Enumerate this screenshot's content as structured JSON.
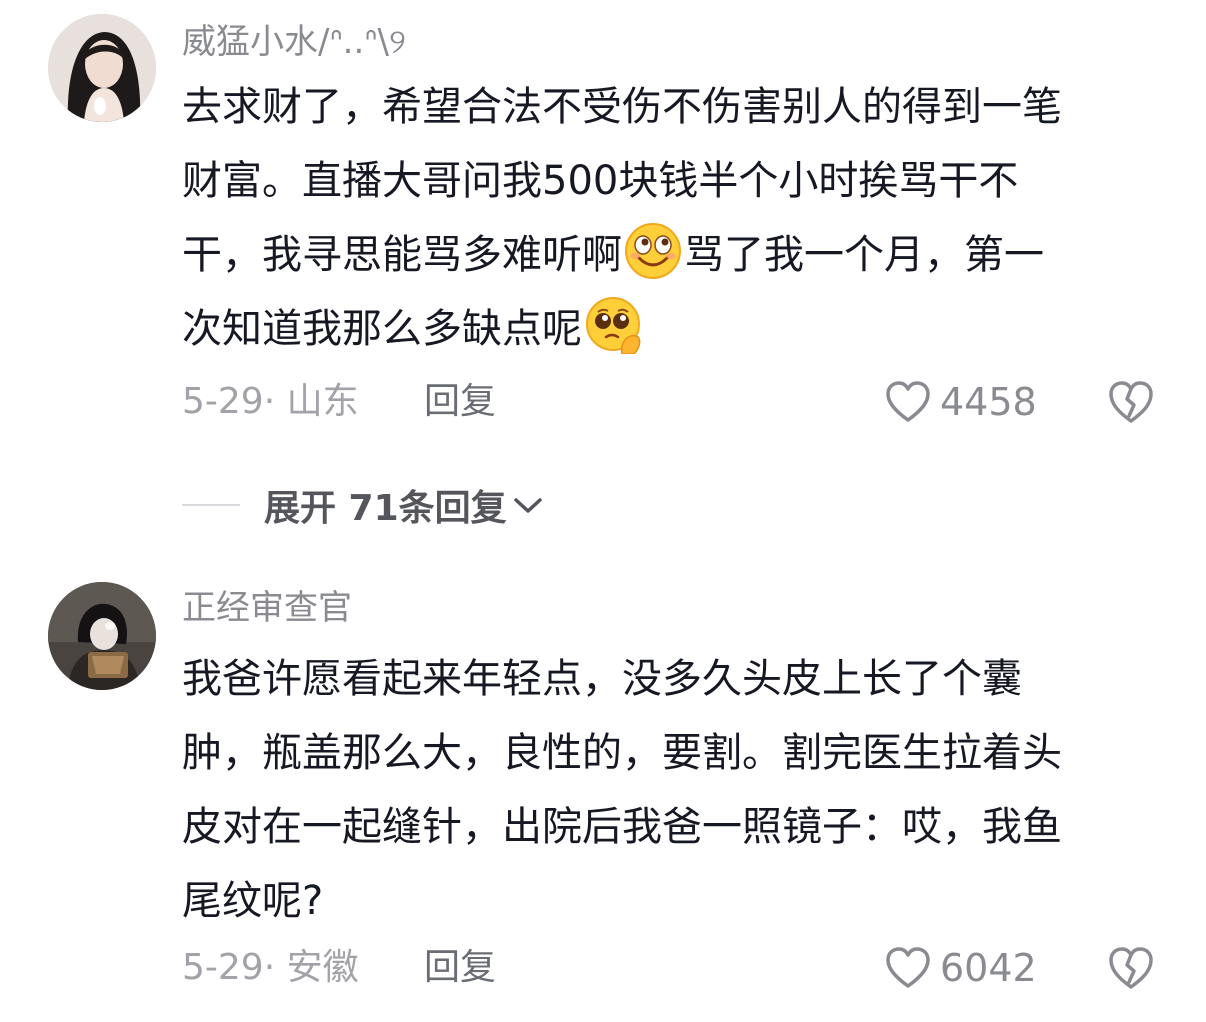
{
  "comments": [
    {
      "username": "威猛小水/ᐢ..ᐢ\\୨",
      "lines": [
        "去求财了，希望合法不受伤不伤害别人的得到一笔",
        "财富。直播大哥问我500块钱半个小时挨骂干不",
        "干，我寻思能骂多难听啊"
      ],
      "line3_after_emoji": "骂了我一个月，第一",
      "line4": "次知道我那么多缺点呢",
      "emoji_1": "grinning-rolling-eyes-emoji",
      "emoji_2": "pleading-face-emoji",
      "date_location": "5-29· 山东",
      "reply_label": "回复",
      "like_count": "4458"
    },
    {
      "username": "正经审查官",
      "lines": [
        "我爸许愿看起来年轻点，没多久头皮上长了个囊",
        "肿，瓶盖那么大，良性的，要割。割完医生拉着头",
        "皮对在一起缝针，出院后我爸一照镜子：哎，我鱼",
        "尾纹呢?"
      ],
      "date_location": "5-29· 安徽",
      "reply_label": "回复",
      "like_count": "6042"
    }
  ],
  "expand_replies": {
    "label": "展开 71条回复"
  },
  "icons": {
    "like": "heart-outline-icon",
    "dislike": "broken-heart-icon",
    "expand": "chevron-down-icon"
  },
  "colors": {
    "text_primary": "#161823",
    "text_secondary": "#8a8b91",
    "text_meta": "#a2a3a8"
  }
}
